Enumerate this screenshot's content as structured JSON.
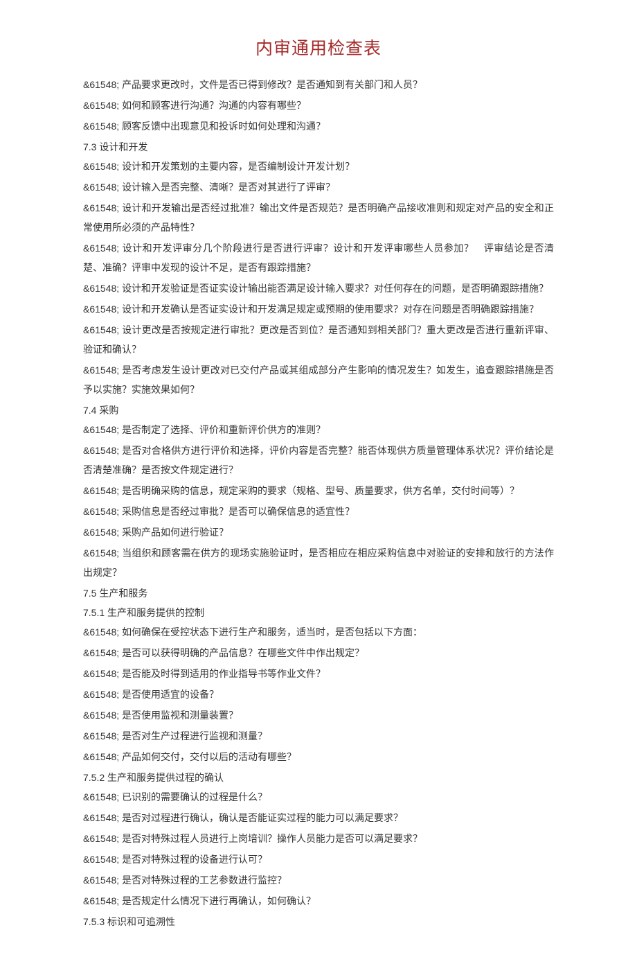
{
  "title": "内审通用检查表",
  "prefix": "&61548;",
  "lines": [
    {
      "type": "item",
      "text": "产品要求更改时，文件是否已得到修改？是否通知到有关部门和人员？"
    },
    {
      "type": "item",
      "text": "如何和顾客进行沟通？沟通的内容有哪些？"
    },
    {
      "type": "item",
      "text": "顾客反馈中出现意见和投诉时如何处理和沟通？"
    },
    {
      "type": "heading",
      "num": "7.3",
      "text": "设计和开发"
    },
    {
      "type": "item",
      "text": "设计和开发策划的主要内容，是否编制设计开发计划？"
    },
    {
      "type": "item",
      "text": "设计输入是否完整、清晰？是否对其进行了评审？"
    },
    {
      "type": "item",
      "text": "设计和开发输出是否经过批准？输出文件是否规范？是否明确产品接收准则和规定对产品的安全和正常使用所必须的产品特性？"
    },
    {
      "type": "item",
      "text": "设计和开发评审分几个阶段进行是否进行评审？设计和开发评审哪些人员参加？　评审结论是否清楚、准确？评审中发现的设计不足，是否有跟踪措施？"
    },
    {
      "type": "item",
      "text": "设计和开发验证是否证实设计输出能否满足设计输入要求？对任何存在的问题，是否明确跟踪措施？"
    },
    {
      "type": "item",
      "text": "设计和开发确认是否证实设计和开发满足规定或预期的使用要求？对存在问题是否明确跟踪措施？"
    },
    {
      "type": "item",
      "text": "设计更改是否按规定进行审批？更改是否到位？是否通知到相关部门？重大更改是否进行重新评审、验证和确认？"
    },
    {
      "type": "item",
      "text": "是否考虑发生设计更改对已交付产品或其组成部分产生影响的情况发生？如发生，追查跟踪措施是否予以实施？实施效果如何？"
    },
    {
      "type": "heading",
      "num": "7.4",
      "text": "采购"
    },
    {
      "type": "item",
      "text": "是否制定了选择、评价和重新评价供方的准则？"
    },
    {
      "type": "item",
      "text": "是否对合格供方进行评价和选择，评价内容是否完整？能否体现供方质量管理体系状况？评价结论是否清楚准确？是否按文件规定进行？"
    },
    {
      "type": "item",
      "text": "是否明确采购的信息，规定采购的要求（规格、型号、质量要求，供方名单，交付时间等）？"
    },
    {
      "type": "item",
      "text": "采购信息是否经过审批？是否可以确保信息的适宜性？"
    },
    {
      "type": "item",
      "text": "采购产品如何进行验证？"
    },
    {
      "type": "item",
      "text": "当组织和顾客需在供方的现场实施验证时，是否相应在相应采购信息中对验证的安排和放行的方法作出规定？"
    },
    {
      "type": "heading",
      "num": "7.5",
      "text": "生产和服务"
    },
    {
      "type": "heading",
      "num": "7.5.1",
      "text": "生产和服务提供的控制"
    },
    {
      "type": "item",
      "text": "如何确保在受控状态下进行生产和服务，适当时，是否包括以下方面："
    },
    {
      "type": "item",
      "text": "是否可以获得明确的产品信息？在哪些文件中作出规定？"
    },
    {
      "type": "item",
      "text": "是否能及时得到适用的作业指导书等作业文件？"
    },
    {
      "type": "item",
      "text": "是否使用适宜的设备？"
    },
    {
      "type": "item",
      "text": "是否使用监视和测量装置？"
    },
    {
      "type": "item",
      "text": "是否对生产过程进行监视和测量？"
    },
    {
      "type": "item",
      "text": "产品如何交付，交付以后的活动有哪些？"
    },
    {
      "type": "heading",
      "num": "7.5.2",
      "text": "生产和服务提供过程的确认"
    },
    {
      "type": "item",
      "text": "已识别的需要确认的过程是什么？"
    },
    {
      "type": "item",
      "text": "是否对过程进行确认，确认是否能证实过程的能力可以满足要求？"
    },
    {
      "type": "item",
      "text": "是否对特殊过程人员进行上岗培训？操作人员能力是否可以满足要求？"
    },
    {
      "type": "item",
      "text": "是否对特殊过程的设备进行认可？"
    },
    {
      "type": "item",
      "text": "是否对特殊过程的工艺参数进行监控？"
    },
    {
      "type": "item",
      "text": "是否规定什么情况下进行再确认，如何确认？"
    },
    {
      "type": "heading",
      "num": "7.5.3",
      "text": "标识和可追溯性"
    }
  ]
}
